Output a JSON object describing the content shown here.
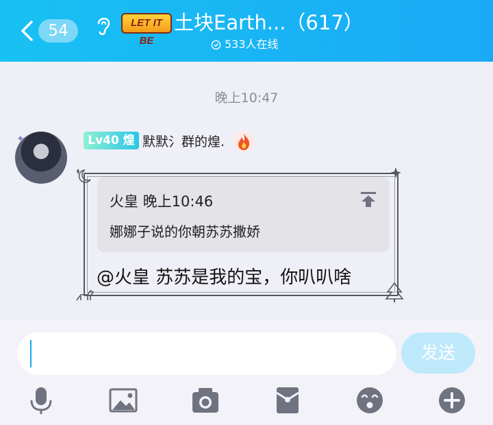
{
  "header": {
    "unread_count": "54",
    "logo_text": "LET IT BE",
    "title": "土块Earth...（617）",
    "online_text": "533人在线"
  },
  "chat": {
    "time_separator": "晚上10:47",
    "message": {
      "level_badge": "Lv40 煌",
      "nickname": "默默氵群的煌.",
      "quote_author_time": "火皇  晚上10:46",
      "quote_text": "娜娜子说的你朝苏苏撒娇",
      "text": "@火皇 苏苏是我的宝，你叭叭啥"
    }
  },
  "composer": {
    "input_value": "",
    "send_label": "发送"
  },
  "toolbar": {
    "icons": [
      "microphone-icon",
      "image-icon",
      "camera-icon",
      "red-packet-icon",
      "emoji-icon",
      "plus-icon"
    ]
  },
  "colors": {
    "header_start": "#18c1f3",
    "header_end": "#1aa9f6",
    "accent": "#14a6ee",
    "icon_gray": "#6f7380"
  }
}
